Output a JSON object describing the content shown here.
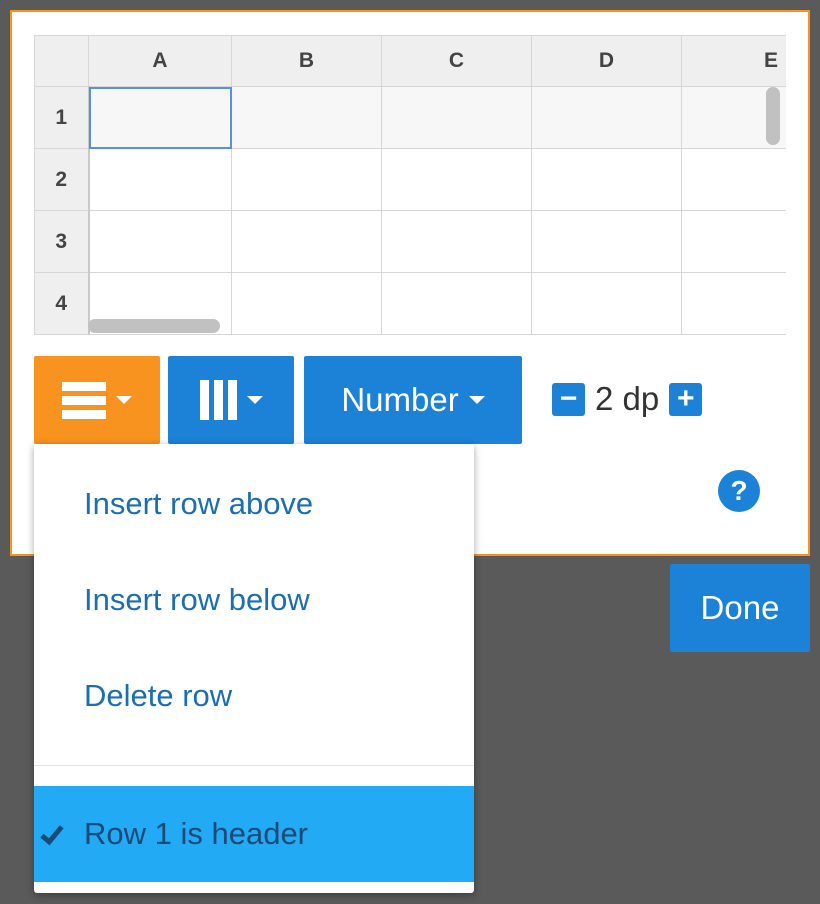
{
  "columns": [
    "A",
    "B",
    "C",
    "D",
    "E"
  ],
  "rows": [
    "1",
    "2",
    "3",
    "4"
  ],
  "toolbar": {
    "number_label": "Number",
    "dp_label": "2 dp",
    "help_label": "?"
  },
  "done_label": "Done",
  "menu": {
    "items": [
      "Insert row above",
      "Insert row below",
      "Delete row"
    ],
    "header_toggle": "Row 1 is header"
  },
  "colors": {
    "accent_orange": "#f7931e",
    "accent_blue": "#1b82d8",
    "highlight": "#22aaf5"
  },
  "icons": [
    "rows-icon",
    "columns-icon",
    "minus-icon",
    "plus-icon",
    "help-icon",
    "check-icon"
  ]
}
